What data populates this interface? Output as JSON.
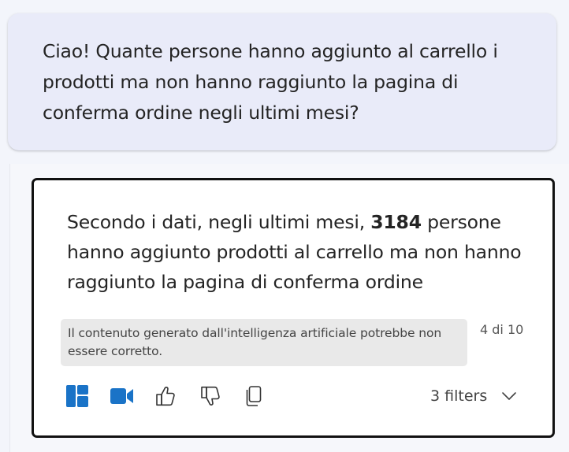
{
  "conversation": {
    "user_message": "Ciao! Quante persone hanno aggiunto al carrello i prodotti ma non hanno raggiunto la pagina di conferma ordine negli ultimi mesi?",
    "assistant": {
      "text_before": "Secondo i dati, negli ultimi mesi, ",
      "highlight_number": "3184",
      "text_after": " persone hanno aggiunto prodotti al carrello ma non hanno raggiunto la pagina di conferma ordine",
      "disclaimer": "Il contenuto generato dall'intelligenza artificiale potrebbe non essere corretto.",
      "page_indicator": "4 di 10"
    }
  },
  "toolbar": {
    "icons": [
      "dashboard-icon",
      "video-icon",
      "thumbs-up-icon",
      "thumbs-down-icon",
      "copy-icon"
    ],
    "filters_label": "3 filters"
  },
  "colors": {
    "accent": "#1a73c7",
    "user_bubble": "#e9ebf9",
    "card_border": "#111111"
  }
}
